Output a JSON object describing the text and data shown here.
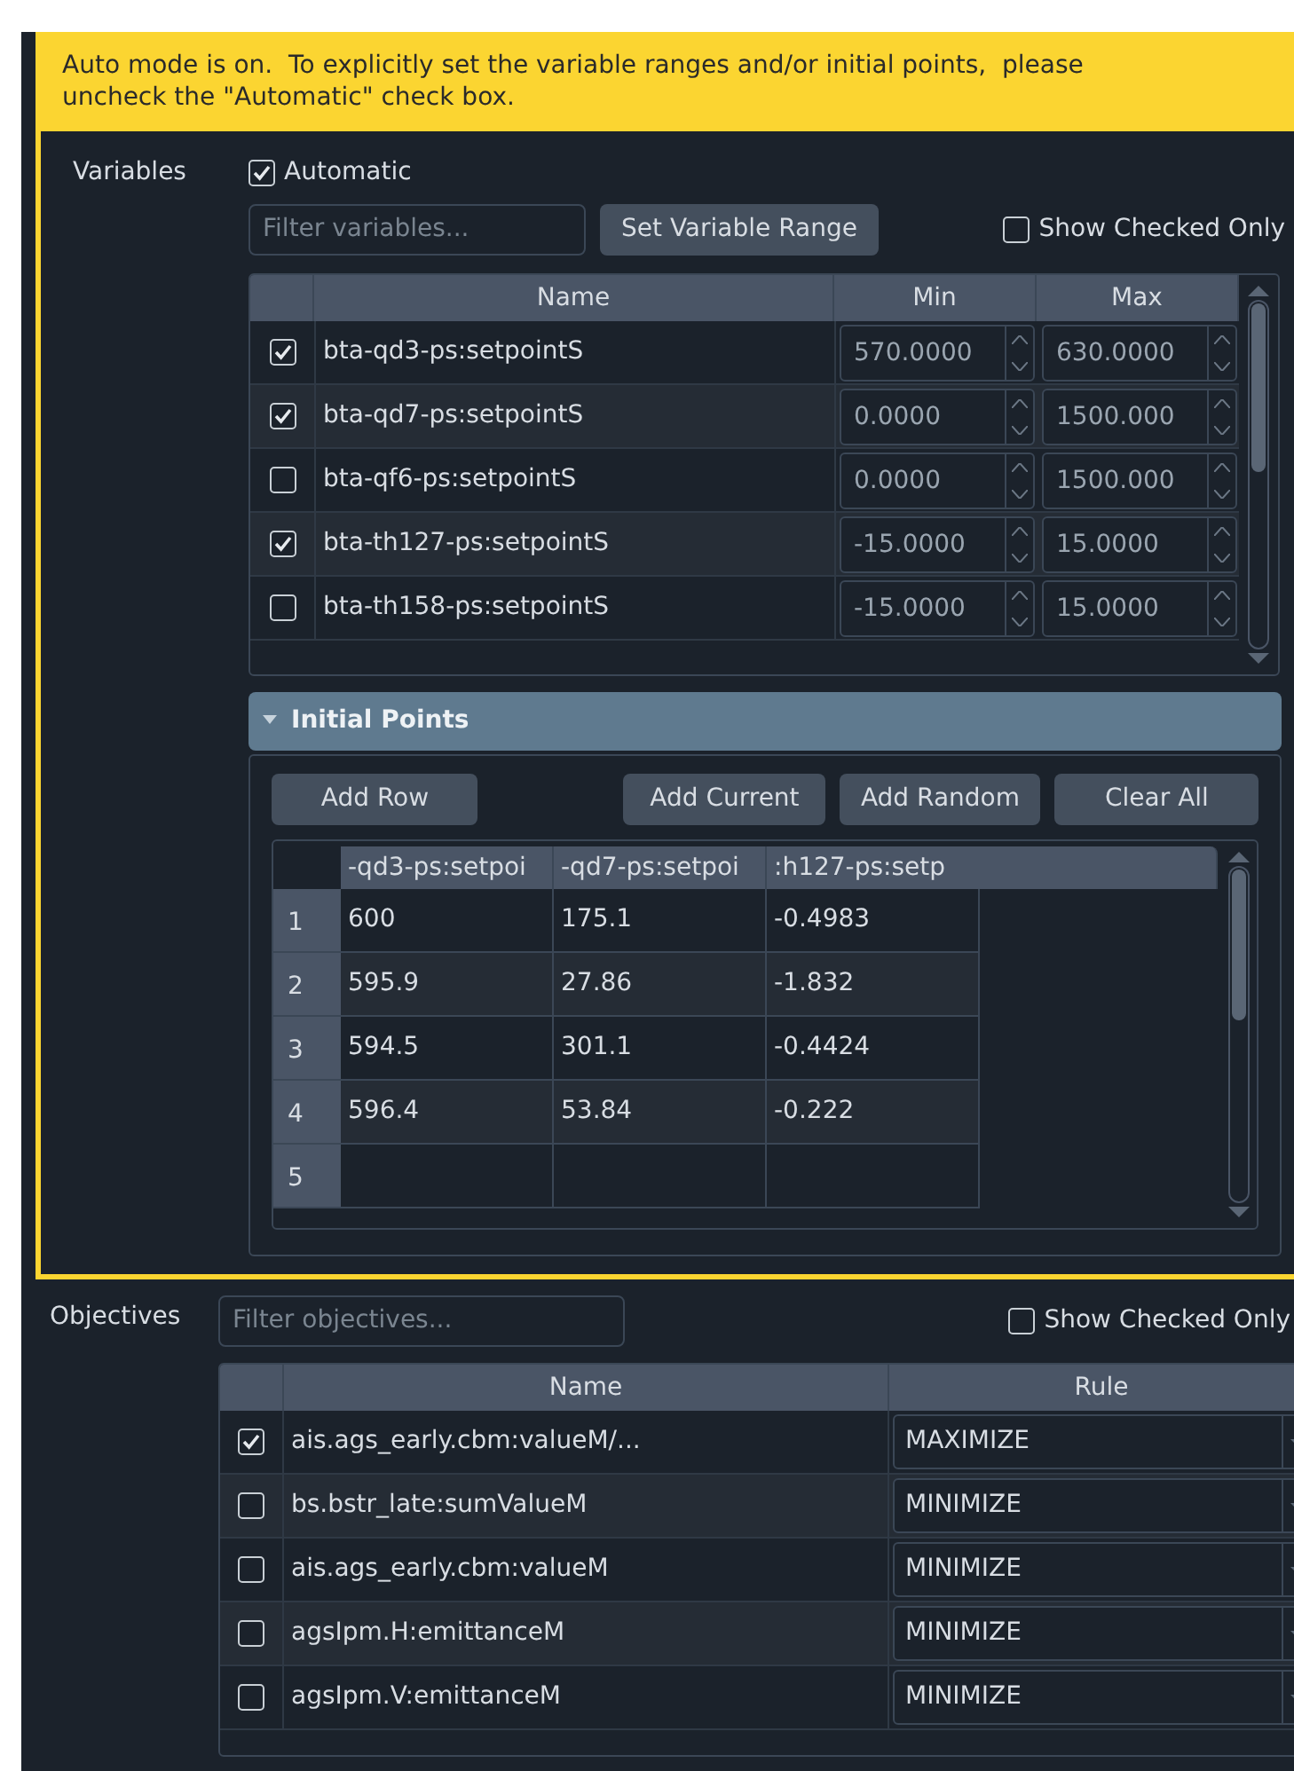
{
  "banner": {
    "text": "Auto mode is on.  To explicitly set the variable ranges and/or initial points,  please uncheck the \"Automatic\" check box."
  },
  "variables": {
    "label": "Variables",
    "automatic": {
      "label": "Automatic",
      "checked": true
    },
    "filter": {
      "placeholder": "Filter variables..."
    },
    "set_range_button": "Set Variable Range",
    "show_checked_only": {
      "label": "Show Checked Only",
      "checked": false
    },
    "table": {
      "columns": [
        "Name",
        "Min",
        "Max"
      ],
      "rows": [
        {
          "checked": true,
          "name": "bta-qd3-ps:setpointS",
          "min": "570.0000",
          "max": "630.0000"
        },
        {
          "checked": true,
          "name": "bta-qd7-ps:setpointS",
          "min": "0.0000",
          "max": "1500.000"
        },
        {
          "checked": false,
          "name": "bta-qf6-ps:setpointS",
          "min": "0.0000",
          "max": "1500.000"
        },
        {
          "checked": true,
          "name": "bta-th127-ps:setpointS",
          "min": "-15.0000",
          "max": "15.0000"
        },
        {
          "checked": false,
          "name": "bta-th158-ps:setpointS",
          "min": "-15.0000",
          "max": "15.0000"
        }
      ]
    }
  },
  "initial_points": {
    "title": "Initial Points",
    "expanded": true,
    "buttons": [
      "Add Row",
      "Add Current",
      "Add Random",
      "Clear All"
    ],
    "table": {
      "columns": [
        "-qd3-ps:setpoi",
        "-qd7-ps:setpoi",
        ":h127-ps:setp"
      ],
      "rows": [
        {
          "index": "1",
          "values": [
            "600",
            "175.1",
            "-0.4983"
          ]
        },
        {
          "index": "2",
          "values": [
            "595.9",
            "27.86",
            "-1.832"
          ]
        },
        {
          "index": "3",
          "values": [
            "594.5",
            "301.1",
            "-0.4424"
          ]
        },
        {
          "index": "4",
          "values": [
            "596.4",
            "53.84",
            "-0.222"
          ]
        },
        {
          "index": "5"
        }
      ]
    }
  },
  "objectives": {
    "label": "Objectives",
    "filter": {
      "placeholder": "Filter objectives..."
    },
    "show_checked_only": {
      "label": "Show Checked Only",
      "checked": false
    },
    "table": {
      "columns": [
        "Name",
        "Rule"
      ],
      "rows": [
        {
          "checked": true,
          "name": "ais.ags_early.cbm:valueM/...",
          "rule": "MAXIMIZE"
        },
        {
          "checked": false,
          "name": "bs.bstr_late:sumValueM",
          "rule": "MINIMIZE"
        },
        {
          "checked": false,
          "name": "ais.ags_early.cbm:valueM",
          "rule": "MINIMIZE"
        },
        {
          "checked": false,
          "name": "agsIpm.H:emittanceM",
          "rule": "MINIMIZE"
        },
        {
          "checked": false,
          "name": "agsIpm.V:emittanceM",
          "rule": "MINIMIZE"
        }
      ]
    }
  }
}
